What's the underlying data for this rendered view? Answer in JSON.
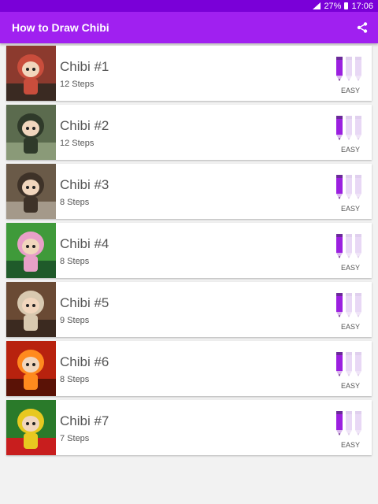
{
  "status_bar": {
    "battery": "27%",
    "time": "17:06"
  },
  "app_bar": {
    "title": "How to Draw Chibi",
    "share_icon": "share-icon"
  },
  "colors": {
    "status_bar": "#7a00d8",
    "app_bar": "#a020f0",
    "pencil_active": "#9b1fe0",
    "pencil_inactive": "#e8d8f5"
  },
  "items": [
    {
      "title": "Chibi #1",
      "steps": "12 Steps",
      "difficulty": "EASY",
      "level": 1,
      "thumb_colors": [
        "#8c3a2e",
        "#c94d3c",
        "#3a2a22"
      ]
    },
    {
      "title": "Chibi #2",
      "steps": "12 Steps",
      "difficulty": "EASY",
      "level": 1,
      "thumb_colors": [
        "#5b6b4e",
        "#2f3a2a",
        "#8a9a78"
      ]
    },
    {
      "title": "Chibi #3",
      "steps": "8 Steps",
      "difficulty": "EASY",
      "level": 1,
      "thumb_colors": [
        "#6a5a48",
        "#3e3228",
        "#a4998a"
      ]
    },
    {
      "title": "Chibi #4",
      "steps": "8 Steps",
      "difficulty": "EASY",
      "level": 1,
      "thumb_colors": [
        "#3f9a3a",
        "#e8a0c8",
        "#1f5a2a"
      ]
    },
    {
      "title": "Chibi #5",
      "steps": "9 Steps",
      "difficulty": "EASY",
      "level": 1,
      "thumb_colors": [
        "#6a4a34",
        "#d8c9b0",
        "#3b2a20"
      ]
    },
    {
      "title": "Chibi #6",
      "steps": "8 Steps",
      "difficulty": "EASY",
      "level": 1,
      "thumb_colors": [
        "#b8220e",
        "#ff8a1e",
        "#5a1206"
      ]
    },
    {
      "title": "Chibi #7",
      "steps": "7 Steps",
      "difficulty": "EASY",
      "level": 1,
      "thumb_colors": [
        "#2a7a2a",
        "#e8c820",
        "#c81e1e"
      ]
    }
  ]
}
